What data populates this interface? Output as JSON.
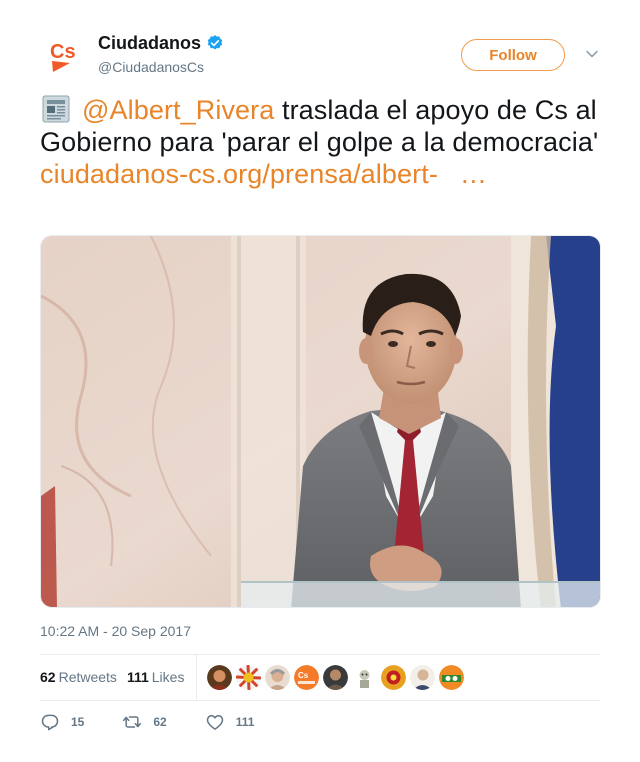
{
  "account": {
    "display_name": "Ciudadanos",
    "handle": "@CiudadanosCs",
    "verified": true,
    "avatar_text": "Cs",
    "brand_color": "#f05a28"
  },
  "follow_button": {
    "label": "Follow"
  },
  "tweet": {
    "emoji": "newspaper-emoji",
    "mention": "@Albert_Rivera",
    "text": " traslada el apoyo de Cs al Gobierno para 'parar el golpe a la democracia' ",
    "link_text": "ciudadanos-cs.org/prensa/albert-",
    "ellipsis": "…",
    "timestamp": "10:22 AM - 20 Sep 2017"
  },
  "stats": {
    "retweets_count": "62",
    "retweets_label": "Retweets",
    "likes_count": "111",
    "likes_label": "Likes",
    "liker_count": 9
  },
  "actions": {
    "replies": "15",
    "retweets": "62",
    "likes": "111"
  },
  "colors": {
    "accent": "#e8852a",
    "text": "#14171a",
    "muted": "#657786",
    "verified": "#1da1f2"
  }
}
